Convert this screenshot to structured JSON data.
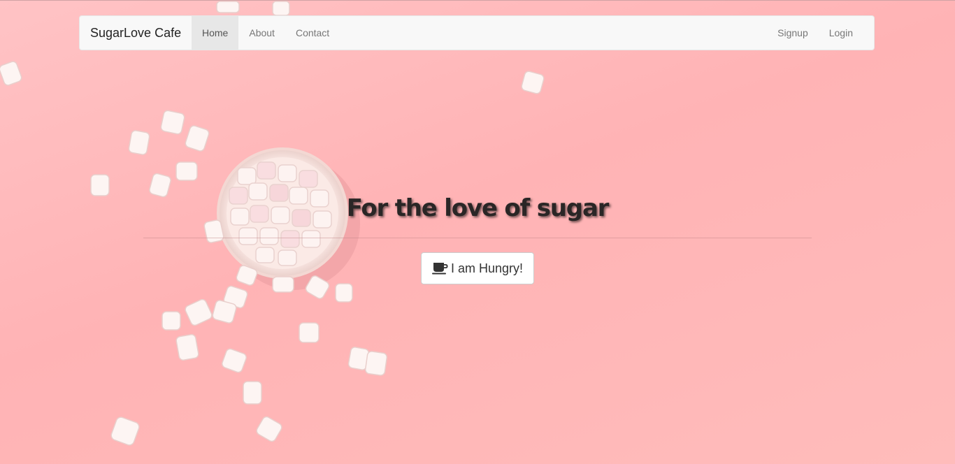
{
  "navbar": {
    "brand": "SugarLove Cafe",
    "left_items": [
      {
        "label": "Home",
        "active": true
      },
      {
        "label": "About",
        "active": false
      },
      {
        "label": "Contact",
        "active": false
      }
    ],
    "right_items": [
      {
        "label": "Signup"
      },
      {
        "label": "Login"
      }
    ]
  },
  "hero": {
    "title": "For the love of sugar",
    "button_label": "I am Hungry!",
    "button_icon": "coffee-cup-icon"
  },
  "colors": {
    "background": "#ffb8ba",
    "navbar_bg": "#f8f8f8",
    "active_tab_bg": "#e7e7e7",
    "title_color": "#2a2626"
  }
}
